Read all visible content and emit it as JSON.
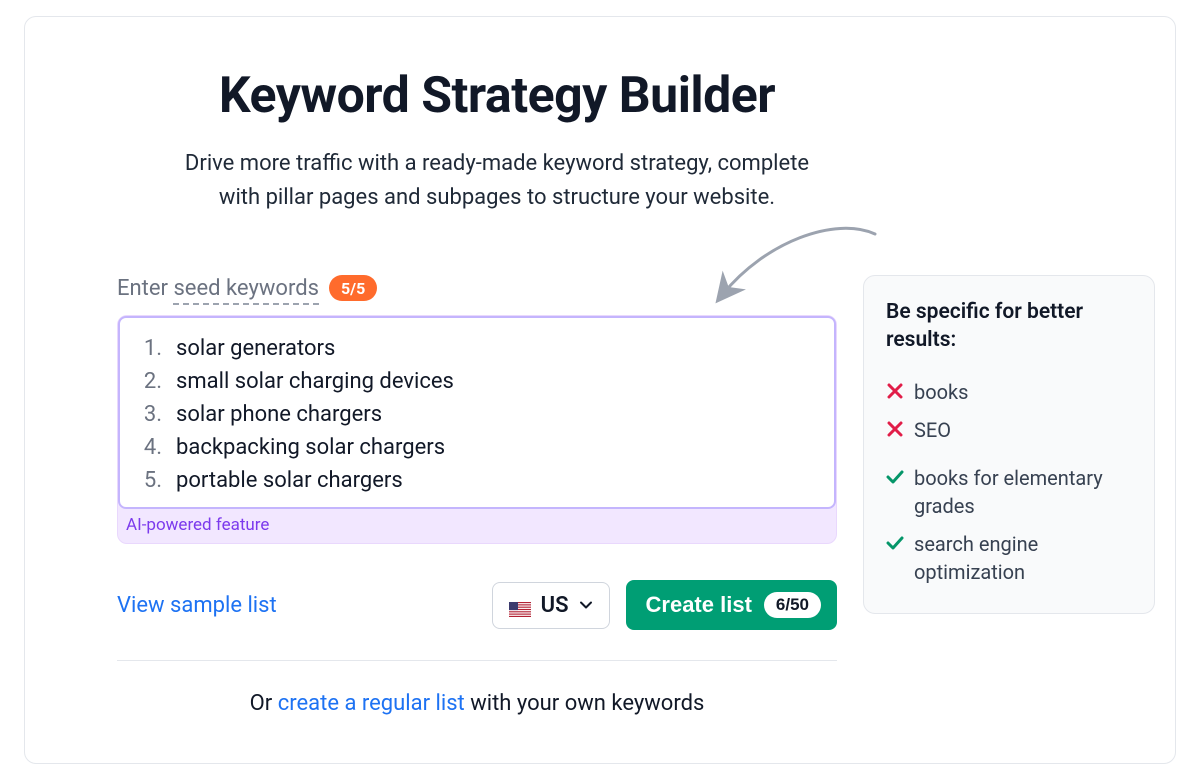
{
  "title": "Keyword Strategy Builder",
  "subtitle_line1": "Drive more traffic with a ready-made keyword strategy, complete",
  "subtitle_line2": "with pillar pages and subpages to structure your website.",
  "label_prefix": "Enter ",
  "label_dotted": "seed keywords",
  "badge_count": "5/5",
  "keywords": [
    "solar generators",
    "small solar charging devices",
    "solar phone chargers",
    "backpacking solar chargers",
    "portable solar chargers"
  ],
  "ai_feature": "AI-powered feature",
  "view_sample": "View sample list",
  "country": {
    "code_label": "US"
  },
  "create_button": {
    "label": "Create list",
    "pill": "6/50"
  },
  "alt": {
    "prefix": "Or ",
    "link": "create a regular list",
    "suffix": " with your own keywords"
  },
  "tip": {
    "title": "Be specific for better results:",
    "bad": [
      "books",
      "SEO"
    ],
    "good": [
      "books for elementary grades",
      "search engine optimization"
    ]
  }
}
